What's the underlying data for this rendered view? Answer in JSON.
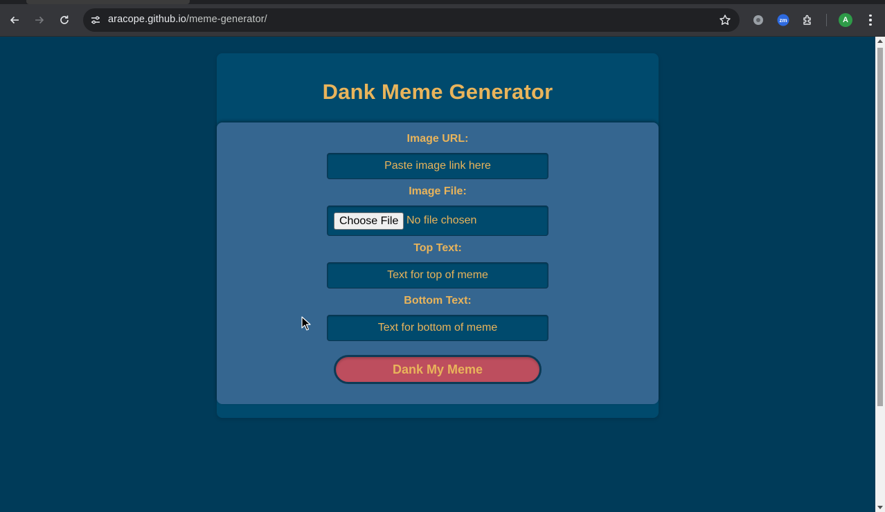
{
  "browser": {
    "url_host": "aracope.github.io",
    "url_path": "/meme-generator/",
    "avatar_letter": "A",
    "extension_label": "zm"
  },
  "page": {
    "title": "Dank Meme Generator",
    "form": {
      "image_url_label": "Image URL:",
      "image_url_placeholder": "Paste image link here",
      "image_file_label": "Image File:",
      "choose_file_label": "Choose File",
      "file_status": "No file chosen",
      "top_text_label": "Top Text:",
      "top_text_placeholder": "Text for top of meme",
      "bottom_text_label": "Bottom Text:",
      "bottom_text_placeholder": "Text for bottom of meme",
      "submit_label": "Dank My Meme"
    }
  },
  "colors": {
    "background": "#003b59",
    "outer_card": "#004a6d",
    "form_card": "#356690",
    "accent_text": "#e9b45b",
    "button": "#bd4e5e"
  }
}
